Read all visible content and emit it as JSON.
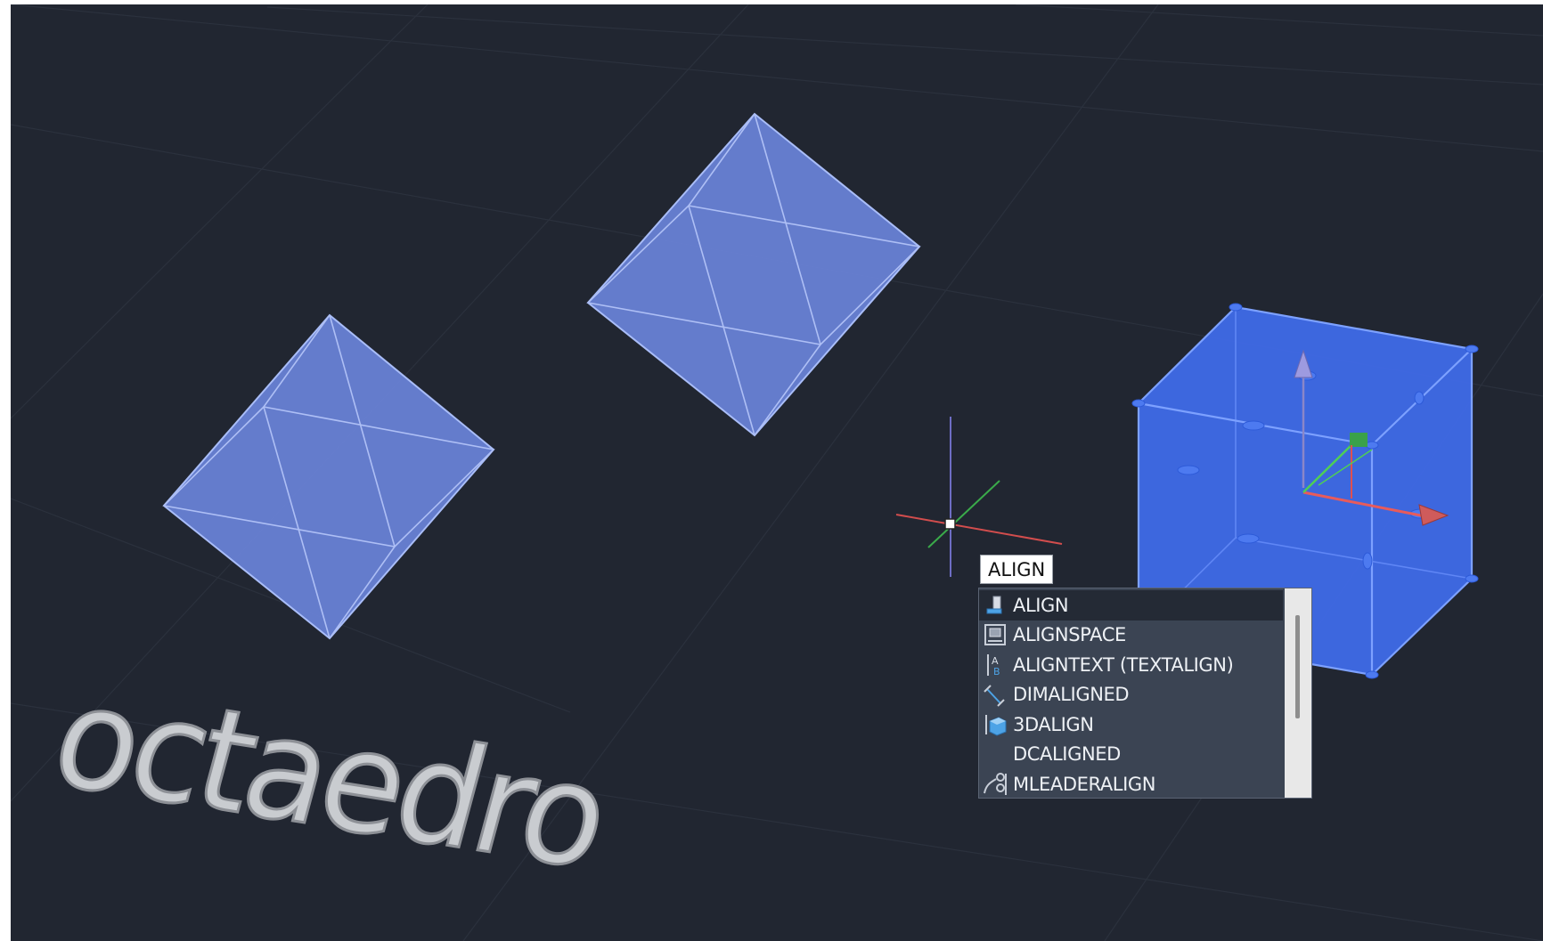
{
  "viewport": {
    "background": "#212631",
    "solid_fill": "#6a83d9",
    "selected_fill": "#3f6ae8",
    "text_3d": "octaedro"
  },
  "command_line": {
    "value": "ALIGN"
  },
  "autocomplete": {
    "items": [
      {
        "label": "ALIGN",
        "icon": "align-icon",
        "selected": true
      },
      {
        "label": "ALIGNSPACE",
        "icon": "alignspace-icon",
        "selected": false
      },
      {
        "label": "ALIGNTEXT (TEXTALIGN)",
        "icon": "aligntext-icon",
        "selected": false
      },
      {
        "label": "DIMALIGNED",
        "icon": "dimaligned-icon",
        "selected": false
      },
      {
        "label": "3DALIGN",
        "icon": "3dalign-icon",
        "selected": false
      },
      {
        "label": "DCALIGNED",
        "icon": "",
        "selected": false
      },
      {
        "label": "MLEADERALIGN",
        "icon": "mleaderalign-icon",
        "selected": false
      }
    ]
  }
}
